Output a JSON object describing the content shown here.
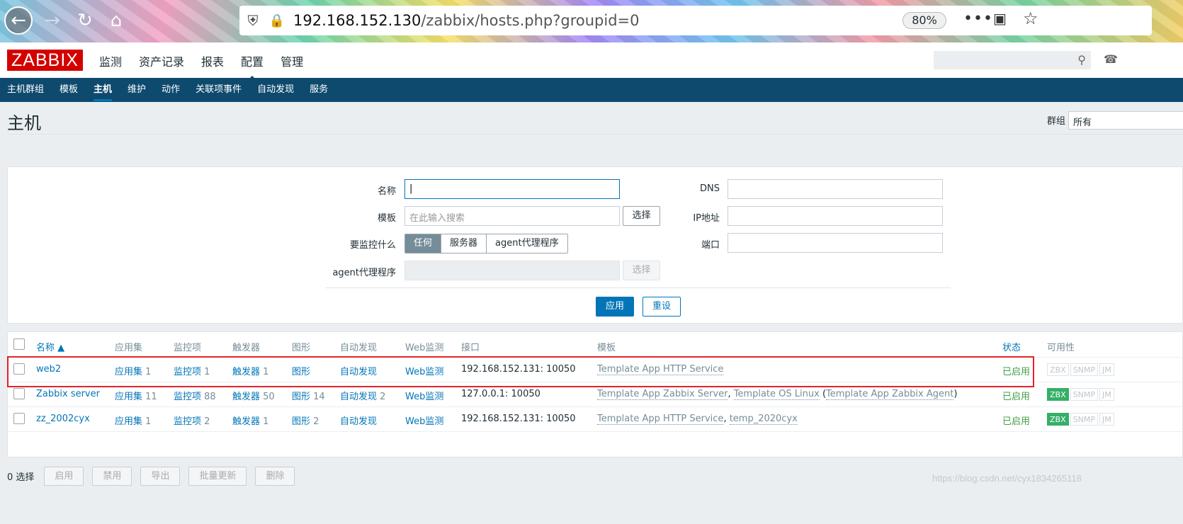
{
  "browser": {
    "url_host": "192.168.152.130",
    "url_path": "/zabbix/hosts.php?groupid=0",
    "zoom": "80%"
  },
  "header": {
    "logo": "ZABBIX",
    "menu": [
      "监测",
      "资产记录",
      "报表",
      "配置",
      "管理"
    ],
    "active_menu": "配置"
  },
  "submenu": [
    "主机群组",
    "模板",
    "主机",
    "维护",
    "动作",
    "关联项事件",
    "自动发现",
    "服务"
  ],
  "page": {
    "title": "主机",
    "group_label": "群组",
    "group_value": "所有"
  },
  "filter": {
    "name_label": "名称",
    "name_value": "",
    "template_label": "模板",
    "template_placeholder": "在此输入搜索",
    "select_button": "选择",
    "monitored_by_label": "要监控什么",
    "monitored_by_options": [
      "任何",
      "服务器",
      "agent代理程序"
    ],
    "proxy_label": "agent代理程序",
    "proxy_select_button": "选择",
    "dns_label": "DNS",
    "ip_label": "IP地址",
    "port_label": "端口",
    "apply": "应用",
    "reset": "重设"
  },
  "table": {
    "columns": [
      "名称 ▲",
      "应用集",
      "监控项",
      "触发器",
      "图形",
      "自动发现",
      "Web监测",
      "接口",
      "模板",
      "状态",
      "可用性"
    ],
    "rows": [
      {
        "name": "web2",
        "apps": "应用集",
        "apps_count": "1",
        "items": "监控项",
        "items_count": "1",
        "triggers": "触发器",
        "triggers_count": "1",
        "graphs": "图形",
        "graphs_count": "",
        "discovery": "自动发现",
        "discovery_count": "",
        "web": "Web监测",
        "interface": "192.168.152.131: 10050",
        "templates": "Template App HTTP Service",
        "status": "已启用",
        "zbx_on": false
      },
      {
        "name": "Zabbix server",
        "apps": "应用集",
        "apps_count": "11",
        "items": "监控项",
        "items_count": "88",
        "triggers": "触发器",
        "triggers_count": "50",
        "graphs": "图形",
        "graphs_count": "14",
        "discovery": "自动发现",
        "discovery_count": "2",
        "web": "Web监测",
        "interface": "127.0.0.1: 10050",
        "templates_a": "Template App Zabbix Server",
        "templates_b": "Template OS Linux",
        "templates_c": "Template App Zabbix Agent",
        "status": "已启用",
        "zbx_on": true
      },
      {
        "name": "zz_2002cyx",
        "apps": "应用集",
        "apps_count": "1",
        "items": "监控项",
        "items_count": "2",
        "triggers": "触发器",
        "triggers_count": "1",
        "graphs": "图形",
        "graphs_count": "2",
        "discovery": "自动发现",
        "discovery_count": "",
        "web": "Web监测",
        "interface": "192.168.152.131: 10050",
        "templates_a": "Template App HTTP Service",
        "templates_b": "temp_2020cyx",
        "status": "已启用",
        "zbx_on": true
      }
    ],
    "availability_badges": [
      "ZBX",
      "SNMP",
      "JM"
    ]
  },
  "footer": {
    "selected": "0 选择",
    "buttons": [
      "启用",
      "禁用",
      "导出",
      "批量更新",
      "删除"
    ]
  },
  "watermark": "https://blog.csdn.net/cyx1834265118"
}
